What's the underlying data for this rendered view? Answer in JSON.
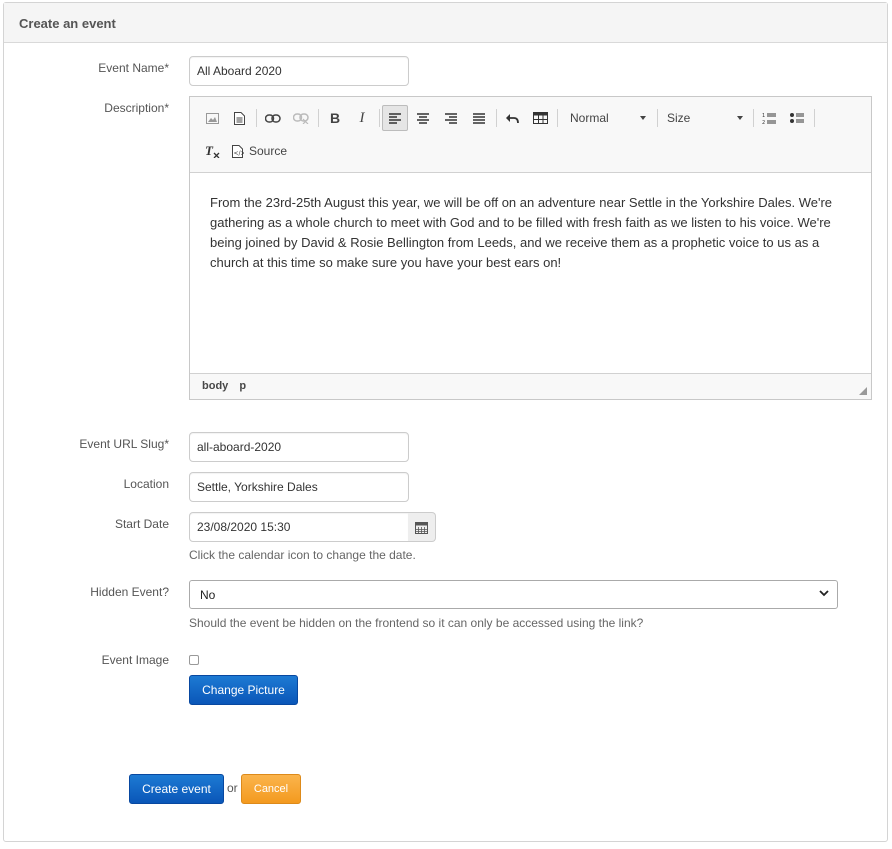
{
  "panel": {
    "title": "Create an event"
  },
  "fields": {
    "event_name": {
      "label": "Event Name*",
      "value": "All Aboard 2020"
    },
    "description": {
      "label": "Description*"
    },
    "slug": {
      "label": "Event URL Slug*",
      "value": "all-aboard-2020"
    },
    "location": {
      "label": "Location",
      "value": "Settle, Yorkshire Dales"
    },
    "start_date": {
      "label": "Start Date",
      "value": "23/08/2020 15:30",
      "help": "Click the calendar icon to change the date."
    },
    "hidden": {
      "label": "Hidden Event?",
      "value": "No",
      "help": "Should the event be hidden on the frontend so it can only be accessed using the link?"
    },
    "image": {
      "label": "Event Image",
      "button": "Change Picture"
    }
  },
  "editor": {
    "format_combo": "Normal",
    "size_combo": "Size",
    "source_label": "Source",
    "content": "From the 23rd-25th August this year, we will be off on an adventure near Settle in the Yorkshire Dales. We're gathering as a whole church to meet with God and to be filled with fresh faith as we listen to his voice. We're being joined by David & Rosie Bellington from Leeds, and we receive them as a prophetic voice to us as a church at this time so make sure you have your best ears on!",
    "path": [
      "body",
      "p"
    ]
  },
  "actions": {
    "submit": "Create event",
    "or": "or",
    "cancel": "Cancel"
  },
  "colors": {
    "primary": "#0a56b8",
    "warning": "#f39a1f"
  }
}
